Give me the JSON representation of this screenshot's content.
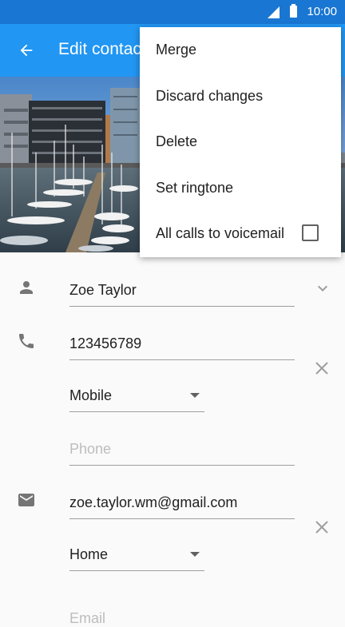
{
  "status_bar": {
    "time": "10:00"
  },
  "app_bar": {
    "title": "Edit contact"
  },
  "form": {
    "name": {
      "value": "Zoe Taylor"
    },
    "phone": {
      "value": "123456789",
      "type": "Mobile",
      "empty_placeholder": "Phone"
    },
    "email": {
      "value": "zoe.taylor.wm@gmail.com",
      "type": "Home",
      "empty_placeholder": "Email"
    }
  },
  "menu": {
    "items": [
      {
        "label": "Merge"
      },
      {
        "label": "Discard changes"
      },
      {
        "label": "Delete"
      },
      {
        "label": "Set ringtone"
      },
      {
        "label": "All calls to voicemail",
        "checked": false
      }
    ]
  },
  "colors": {
    "status_bar": "#1976d2",
    "app_bar": "#2196f3"
  }
}
